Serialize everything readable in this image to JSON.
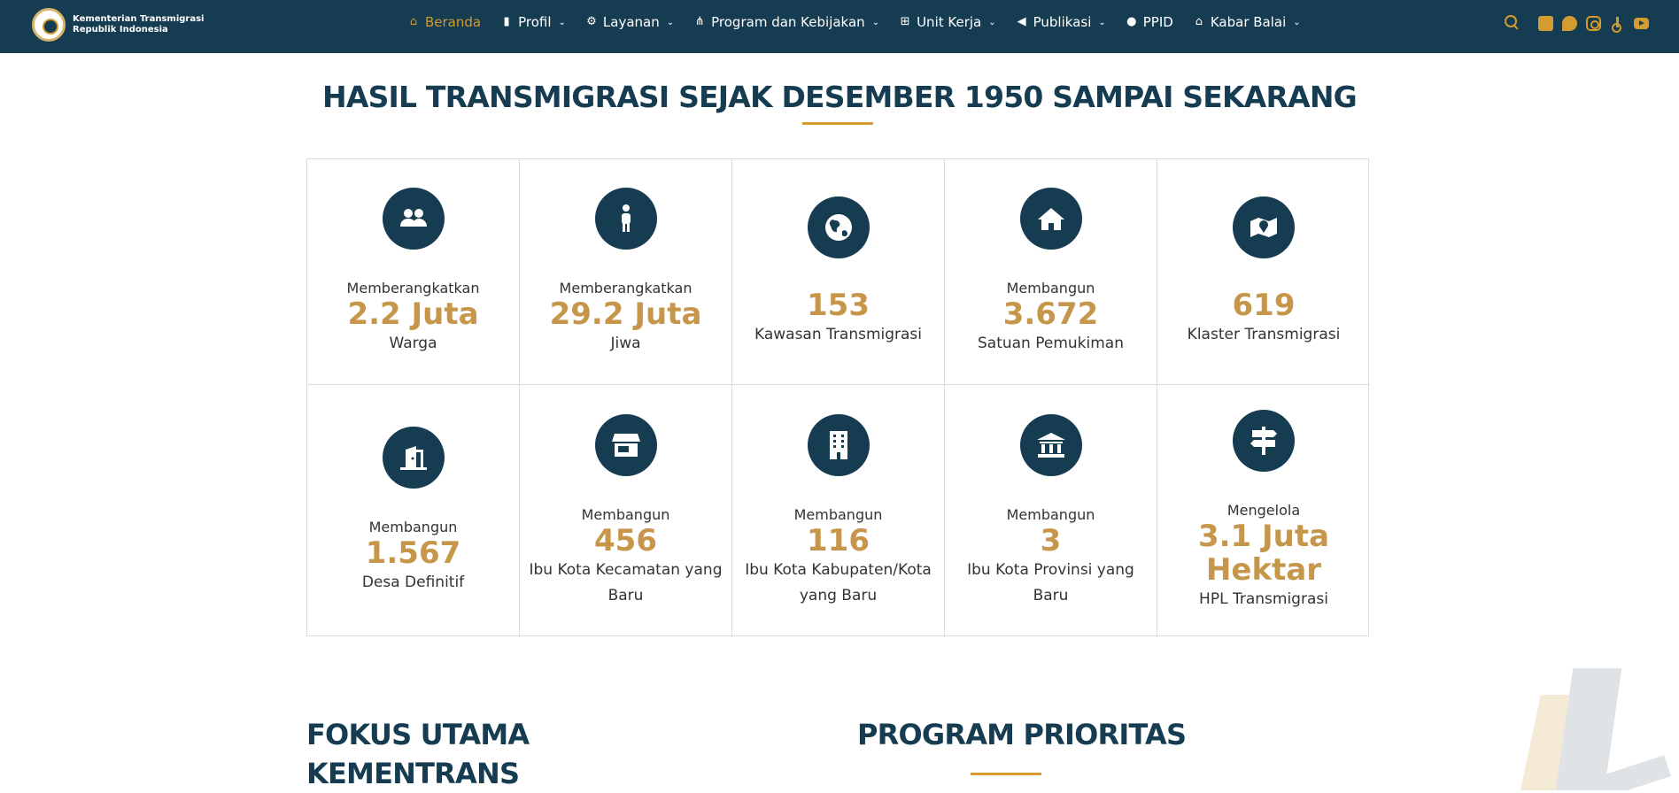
{
  "brand": {
    "line1": "Kementerian Transmigrasi",
    "line2": "Republik Indonesia"
  },
  "nav": {
    "items": [
      {
        "label": "Beranda",
        "icon": "home-icon",
        "dropdown": false,
        "active": true
      },
      {
        "label": "Profil",
        "icon": "building-icon",
        "dropdown": true,
        "active": false
      },
      {
        "label": "Layanan",
        "icon": "gear-icon",
        "dropdown": true,
        "active": false
      },
      {
        "label": "Program dan Kebijakan",
        "icon": "network-icon",
        "dropdown": true,
        "active": false
      },
      {
        "label": "Unit Kerja",
        "icon": "sitemap-icon",
        "dropdown": true,
        "active": false
      },
      {
        "label": "Publikasi",
        "icon": "megaphone-icon",
        "dropdown": true,
        "active": false
      },
      {
        "label": "PPID",
        "icon": "user-gear-icon",
        "dropdown": false,
        "active": false
      },
      {
        "label": "Kabar Balai",
        "icon": "school-icon",
        "dropdown": true,
        "active": false
      }
    ],
    "socials": [
      "facebook-icon",
      "twitter-icon",
      "instagram-icon",
      "tiktok-icon",
      "youtube-icon"
    ]
  },
  "colors": {
    "navy": "#163c52",
    "gold": "#d39b30",
    "value_gold": "#c6974a"
  },
  "section": {
    "title": "HASIL TRANSMIGRASI SEJAK DESEMBER 1950 SAMPAI SEKARANG"
  },
  "stats": [
    {
      "icon": "users-icon",
      "pre": "Memberangkatkan",
      "value": "2.2 Juta",
      "post": "Warga"
    },
    {
      "icon": "person-icon",
      "pre": "Memberangkatkan",
      "value": "29.2 Juta",
      "post": "Jiwa"
    },
    {
      "icon": "globe-icon",
      "pre": "",
      "value": "153",
      "post": "Kawasan Transmigrasi"
    },
    {
      "icon": "house-icon",
      "pre": "Membangun",
      "value": "3.672",
      "post": "Satuan Pemukiman"
    },
    {
      "icon": "map-location-icon",
      "pre": "",
      "value": "619",
      "post": "Klaster Transmigrasi"
    },
    {
      "icon": "door-open-icon",
      "pre": "Membangun",
      "value": "1.567",
      "post": "Desa Definitif"
    },
    {
      "icon": "store-icon",
      "pre": "Membangun",
      "value": "456",
      "post": "Ibu Kota Kecamatan yang Baru"
    },
    {
      "icon": "office-building-icon",
      "pre": "Membangun",
      "value": "116",
      "post": "Ibu Kota Kabupaten/Kota yang Baru"
    },
    {
      "icon": "landmark-icon",
      "pre": "Membangun",
      "value": "3",
      "post": "Ibu Kota Provinsi yang Baru"
    },
    {
      "icon": "signpost-icon",
      "pre": "Mengelola",
      "value": "3.1 Juta Hektar",
      "post": "HPL Transmigrasi"
    }
  ],
  "fokus": {
    "line1": "FOKUS UTAMA",
    "line2": "KEMENTRANS"
  },
  "program": {
    "title": "PROGRAM PRIORITAS"
  }
}
